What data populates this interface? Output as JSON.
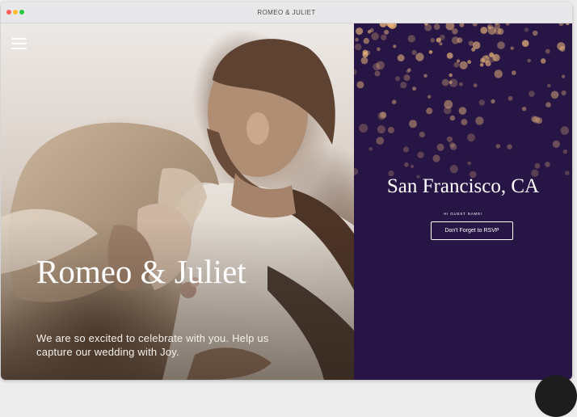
{
  "window": {
    "title": "ROMEO & JULIET"
  },
  "hero": {
    "title": "Romeo & Juliet",
    "tagline": "We are so excited to celebrate with you. Help us capture our wedding with Joy."
  },
  "event": {
    "location": "San Francisco, CA",
    "guest_label": "HI GUEST NAME!",
    "rsvp_label": "Don't Forget to RSVP"
  },
  "icons": {
    "menu": "hamburger-menu-icon"
  },
  "colors": {
    "event_background": "#271645",
    "bokeh_gold": "#e8b47a",
    "text_light": "#ffffff"
  }
}
